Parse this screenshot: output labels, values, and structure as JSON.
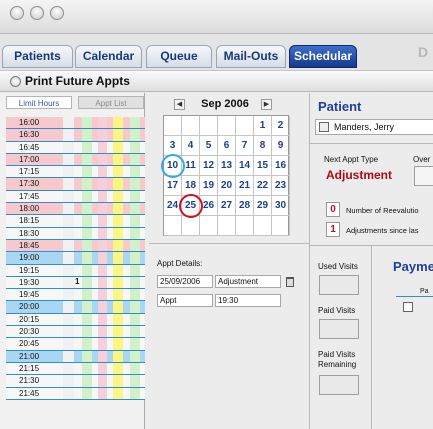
{
  "tabs": [
    {
      "label": "Patients",
      "active": false
    },
    {
      "label": "Calendar",
      "active": false
    },
    {
      "label": "Queue",
      "active": false
    },
    {
      "label": "Mail-Outs",
      "active": false
    },
    {
      "label": "Schedular",
      "active": true
    }
  ],
  "brand_fragment": "D",
  "print_future_label": "Print Future Appts",
  "left_panel": {
    "tab_limit_hours": "Limit Hours",
    "tab_appt_list": "Appt List",
    "times": [
      "16:00",
      "16:30",
      "16:45",
      "17:00",
      "17:15",
      "17:30",
      "17:45",
      "18:00",
      "18:15",
      "18:30",
      "18:45",
      "19:00",
      "19:15",
      "19:30",
      "19:45",
      "20:00",
      "20:15",
      "20:30",
      "20:45",
      "21:00",
      "21:15",
      "21:30",
      "21:45"
    ],
    "highlighted_times": [
      "16:00",
      "16:30",
      "17:00",
      "17:30",
      "18:00",
      "18:45"
    ],
    "selected_times": [
      "19:00",
      "20:00",
      "21:00"
    ],
    "booking_mark_time": "19:30",
    "booking_mark": "1"
  },
  "calendar": {
    "month_label": "Sep 2006",
    "prev_icon": "triangle-left-icon",
    "next_icon": "triangle-right-icon",
    "weeks": [
      [
        "",
        "",
        "",
        "",
        "",
        "1",
        "2"
      ],
      [
        "3",
        "4",
        "5",
        "6",
        "7",
        "8",
        "9"
      ],
      [
        "10",
        "11",
        "12",
        "13",
        "14",
        "15",
        "16"
      ],
      [
        "17",
        "18",
        "19",
        "20",
        "21",
        "22",
        "23"
      ],
      [
        "24",
        "25",
        "26",
        "27",
        "28",
        "29",
        "30"
      ],
      [
        "",
        "",
        "",
        "",
        "",
        "",
        ""
      ]
    ],
    "today": "10",
    "selected": "25"
  },
  "appt": {
    "label": "Appt Details:",
    "date": "25/09/2006",
    "type": "Adjustment",
    "kind": "Appt",
    "time": "19:30"
  },
  "visits": {
    "used_label": "Used Visits",
    "paid_label": "Paid Visits",
    "remaining_label_line1": "Paid Visits",
    "remaining_label_line2": "Remaining"
  },
  "patient": {
    "title": "Patient",
    "name": "Manders, Jerry",
    "next_type_label": "Next Appt Type",
    "next_type_value": "Adjustment",
    "override_label": "Over",
    "reevaluations_count": "0",
    "reevaluations_label": "Number of Reevalutio",
    "adjustments_count": "1",
    "adjustments_label": "Adjustments since las"
  },
  "payments": {
    "title": "Payme",
    "column": "Pa"
  },
  "colors": {
    "accent": "#1f3f9a",
    "alert": "#b00a14",
    "hour_highlight": "#f7c9cc",
    "selected_row": "#a9d6f2",
    "band_green": "#d3f1c9",
    "band_pink": "#f7cfd8",
    "band_yellow": "#fbf583"
  }
}
